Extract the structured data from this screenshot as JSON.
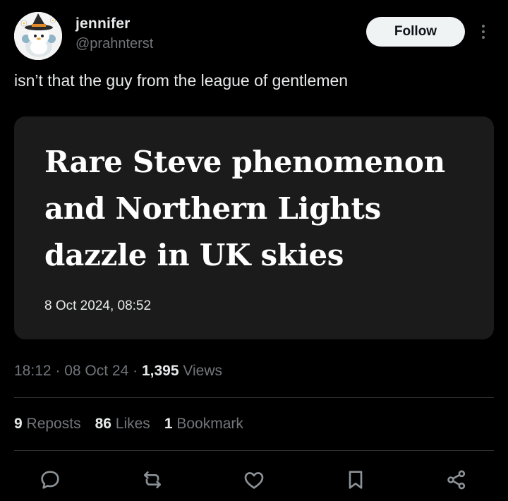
{
  "author": {
    "display_name": "jennifer",
    "handle": "@prahnterst",
    "avatar_icon": "penguin-witch-avatar"
  },
  "header": {
    "follow_label": "Follow",
    "more_icon": "more-vertical-icon"
  },
  "post": {
    "text": "isn’t that the guy from the league of gentlemen"
  },
  "card": {
    "headline": "Rare Steve phenomenon and Northern Lights dazzle in UK skies",
    "date": "8 Oct 2024, 08:52"
  },
  "meta": {
    "time": "18:12",
    "date": "08 Oct 24",
    "separator": " · ",
    "views_count": "1,395",
    "views_label": "Views"
  },
  "stats": {
    "reposts_count": "9",
    "reposts_label": "Reposts",
    "likes_count": "86",
    "likes_label": "Likes",
    "bookmarks_count": "1",
    "bookmarks_label": "Bookmark"
  },
  "actions": [
    {
      "icon": "reply-icon"
    },
    {
      "icon": "repost-icon"
    },
    {
      "icon": "like-icon"
    },
    {
      "icon": "bookmark-icon"
    },
    {
      "icon": "share-icon"
    }
  ],
  "colors": {
    "background": "#000000",
    "text_primary": "#e7e9ea",
    "text_secondary": "#71767b",
    "card_background": "#1b1b1b",
    "follow_button_bg": "#eff3f4",
    "divider": "#2f3336"
  }
}
